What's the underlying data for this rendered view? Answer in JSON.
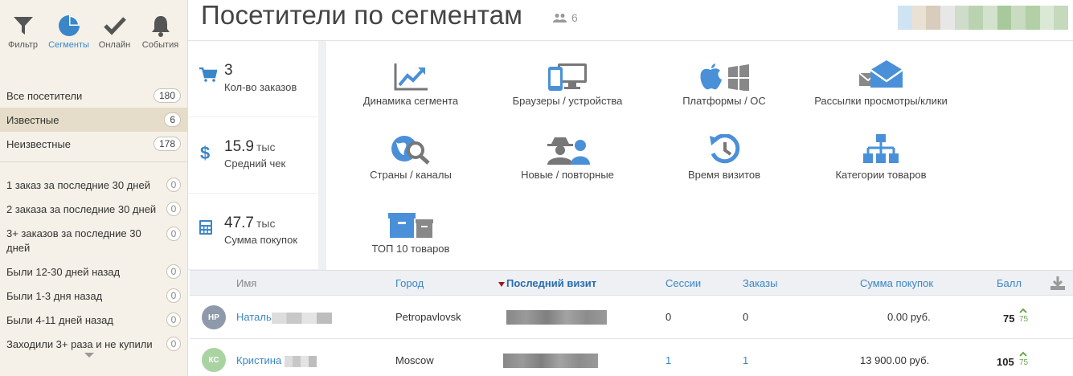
{
  "toolbar": {
    "filter_label": "Фильтр",
    "segments_label": "Сегменты",
    "online_label": "Онлайн",
    "events_label": "События"
  },
  "segments": {
    "main": [
      {
        "label": "Все посетители",
        "count": "180"
      },
      {
        "label": "Известные",
        "count": "6"
      },
      {
        "label": "Неизвестные",
        "count": "178"
      }
    ],
    "custom": [
      {
        "label": "1 заказ за последние 30 дней",
        "count": "0"
      },
      {
        "label": "2 заказа за последние 30 дней",
        "count": "0"
      },
      {
        "label": "3+ заказов за последние 30 дней",
        "count": "0"
      },
      {
        "label": "Были 12-30 дней назад",
        "count": "0"
      },
      {
        "label": "Были 1-3 дня назад",
        "count": "0"
      },
      {
        "label": "Были 4-11 дней назад",
        "count": "0"
      },
      {
        "label": "Заходили 3+ раза и не купили",
        "count": "0"
      }
    ]
  },
  "header": {
    "title": "Посетители по сегментам",
    "users_count": "6"
  },
  "metrics": [
    {
      "value": "3",
      "unit": "",
      "caption": "Кол-во заказов",
      "icon": "cart-icon"
    },
    {
      "value": "15.9",
      "unit": "тыс",
      "caption": "Средний чек",
      "icon": "dollar-icon"
    },
    {
      "value": "47.7",
      "unit": "тыс",
      "caption": "Сумма покупок",
      "icon": "calculator-icon"
    }
  ],
  "reports": [
    {
      "label": "Динамика сегмента",
      "icon": "line-chart-icon"
    },
    {
      "label": "Браузеры / устройства",
      "icon": "devices-icon"
    },
    {
      "label": "Платформы / ОС",
      "icon": "platforms-icon"
    },
    {
      "label": "Рассылки просмотры/клики",
      "icon": "mail-icon"
    },
    {
      "label": "Страны / каналы",
      "icon": "globe-search-icon"
    },
    {
      "label": "Новые / повторные",
      "icon": "spy-user-icon"
    },
    {
      "label": "Время визитов",
      "icon": "history-icon"
    },
    {
      "label": "Категории товаров",
      "icon": "sitemap-icon"
    },
    {
      "label": "ТОП 10 товаров",
      "icon": "boxes-icon"
    }
  ],
  "table": {
    "columns": {
      "name": "Имя",
      "city": "Город",
      "last_visit": "Последний визит",
      "sessions": "Сессии",
      "orders": "Заказы",
      "purchases": "Сумма покупок",
      "score": "Балл"
    },
    "rows": [
      {
        "initials": "НР",
        "avatar_color": "#8e9aab",
        "name": "Наталь",
        "city": "Petropavlovsk",
        "sessions": "0",
        "orders": "0",
        "purchases": "0.00 руб.",
        "score": "75",
        "score_small": "75"
      },
      {
        "initials": "КС",
        "avatar_color": "#a9d3a0",
        "name": "Кристина",
        "city": "Moscow",
        "sessions": "1",
        "orders": "1",
        "purchases": "13 900.00 руб.",
        "score": "105",
        "score_small": "75"
      }
    ]
  },
  "colors": {
    "accent": "#3a86c8",
    "sidebar_bg": "#f5f1e8",
    "selected_bg": "#e5ddc9",
    "icon_blue": "#4a90d9",
    "icon_gray": "#777777"
  }
}
